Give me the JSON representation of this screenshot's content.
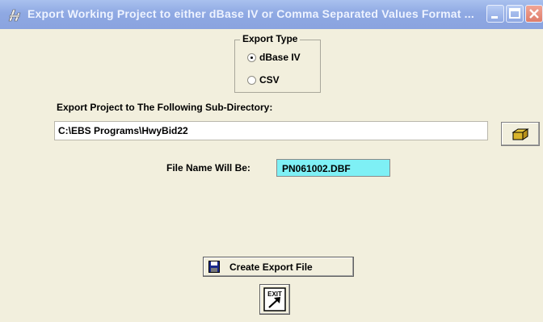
{
  "window": {
    "title": "Export Working Project to either dBase IV or Comma Separated Values Format ..."
  },
  "export_type": {
    "legend": "Export Type",
    "options": [
      {
        "label": "dBase IV",
        "checked": true
      },
      {
        "label": "CSV",
        "checked": false
      }
    ]
  },
  "subdirectory": {
    "label": "Export Project to The Following Sub-Directory:",
    "value": "C:\\EBS Programs\\HwyBid22"
  },
  "file_name": {
    "label": "File Name Will Be:",
    "value": "PN061002.DBF"
  },
  "buttons": {
    "create_label": "Create Export File",
    "exit_label": "EXIT"
  },
  "icons": {
    "app": "app-icon",
    "minimize": "minimize-icon",
    "maximize": "maximize-icon",
    "close": "close-icon",
    "browse": "folder-icon",
    "create": "floppy-disk-icon",
    "exit": "exit-icon"
  },
  "colors": {
    "titlebar": "#8fa9e3",
    "window_bg": "#f2efdd",
    "filename_bg": "#7ef0f5"
  }
}
